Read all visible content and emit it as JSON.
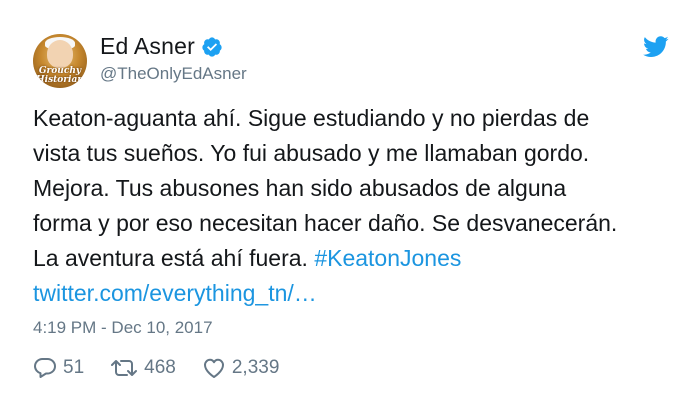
{
  "tweet": {
    "avatar": {
      "icon": "profile-avatar",
      "caption_lines": [
        "Grouchy",
        "Historian"
      ]
    },
    "display_name": "Ed Asner",
    "verified_icon": "verified-badge-icon",
    "handle": "@TheOnlyEdAsner",
    "brand_icon": "twitter-bird-icon",
    "body_lines": [
      "Keaton-aguanta ahí. Sigue estudiando y no pierdas de",
      "vista tus sueños. Yo fui abusado y me llamaban gordo.",
      "Mejora. Tus abusones han sido abusados de alguna",
      "forma y por eso necesitan hacer daño. Se desvanecerán.",
      "La aventura está ahí fuera. "
    ],
    "hashtag": "#KeatonJones",
    "link": "twitter.com/everything_tn/…",
    "timestamp": "4:19 PM - Dec 10, 2017",
    "actions": {
      "reply_count": "51",
      "retweet_count": "468",
      "like_count": "2,339"
    }
  },
  "colors": {
    "link": "#1b95e0",
    "muted": "#657786",
    "text": "#14171a",
    "verified": "#1da1f2"
  }
}
